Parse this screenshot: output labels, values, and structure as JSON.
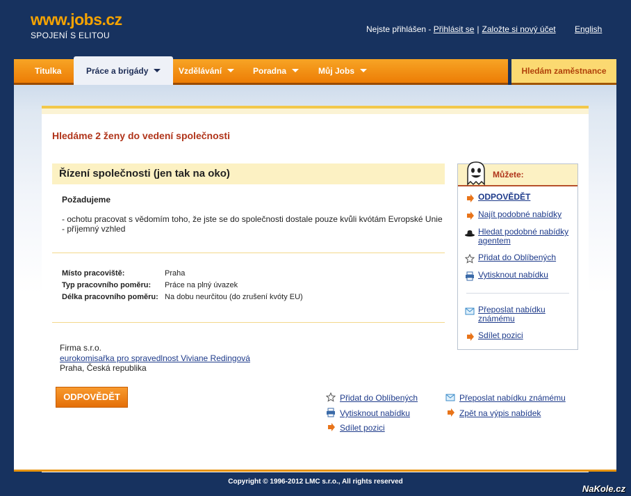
{
  "header": {
    "logo_name": "www.jobs.cz",
    "logo_tagline": "SPOJENÍ S ELITOU",
    "login_status": "Nejste přihlášen - ",
    "login_link": "Přihlásit se",
    "separator": "|",
    "register_link": "Založte si nový účet",
    "language_link": "English"
  },
  "nav": {
    "items": [
      {
        "label": "Titulka"
      },
      {
        "label": "Práce a brigády"
      },
      {
        "label": "Vzdělávání"
      },
      {
        "label": "Poradna"
      },
      {
        "label": "Můj Jobs"
      }
    ],
    "employer_label": "Hledám zaměstnance"
  },
  "job": {
    "title": "Hledáme 2 ženy do vedení společnosti",
    "section_title": "Řízení společnosti (jen tak na oko)",
    "requirements_label": "Požadujeme",
    "requirements": [
      "- ochotu pracovat s vědomím toho, že jste se do společnosti dostale pouze kvůli kvótám Evropské Unie",
      "- příjemný vzhled"
    ],
    "details": [
      {
        "key": "Místo pracoviště:",
        "value": "Praha"
      },
      {
        "key": "Typ pracovního poměru:",
        "value": "Práce na plný úvazek"
      },
      {
        "key": "Délka pracovního poměru:",
        "value": "Na dobu neurčitou (do zrušení kvóty EU)"
      }
    ],
    "company_name": "Firma s.r.o.",
    "contact_link": "eurokomisařka pro spravedlnost Viviane Redingová",
    "location": "Praha, Česká republika",
    "reply_button": "ODPOVĚDĚT"
  },
  "bottom_actions": {
    "favorite": "Přidat do Oblíbených",
    "print": "Vytisknout nabídku",
    "share": "Sdílet pozici",
    "forward": "Přeposlat nabídku známému",
    "back": "Zpět na výpis nabídek"
  },
  "side": {
    "heading": "Můžete:",
    "reply": "ODPOVĚDĚT",
    "find_similar": "Najít podobné nabídky",
    "agent_search": "Hledat podobné nabídky agentem",
    "favorite": "Přidat do Oblíbených",
    "print": "Vytisknout nabídku",
    "forward": "Přeposlat nabídku známému",
    "share": "Sdílet pozici"
  },
  "footer": {
    "copyright": "Copyright © 1996-2012  LMC s.r.o., All rights reserved",
    "watermark": "NaKole.cz"
  },
  "colors": {
    "background": "#17325f",
    "accent_orange": "#ed7d05",
    "title_red": "#b0341a",
    "highlight_yellow": "#fcf1c3"
  }
}
